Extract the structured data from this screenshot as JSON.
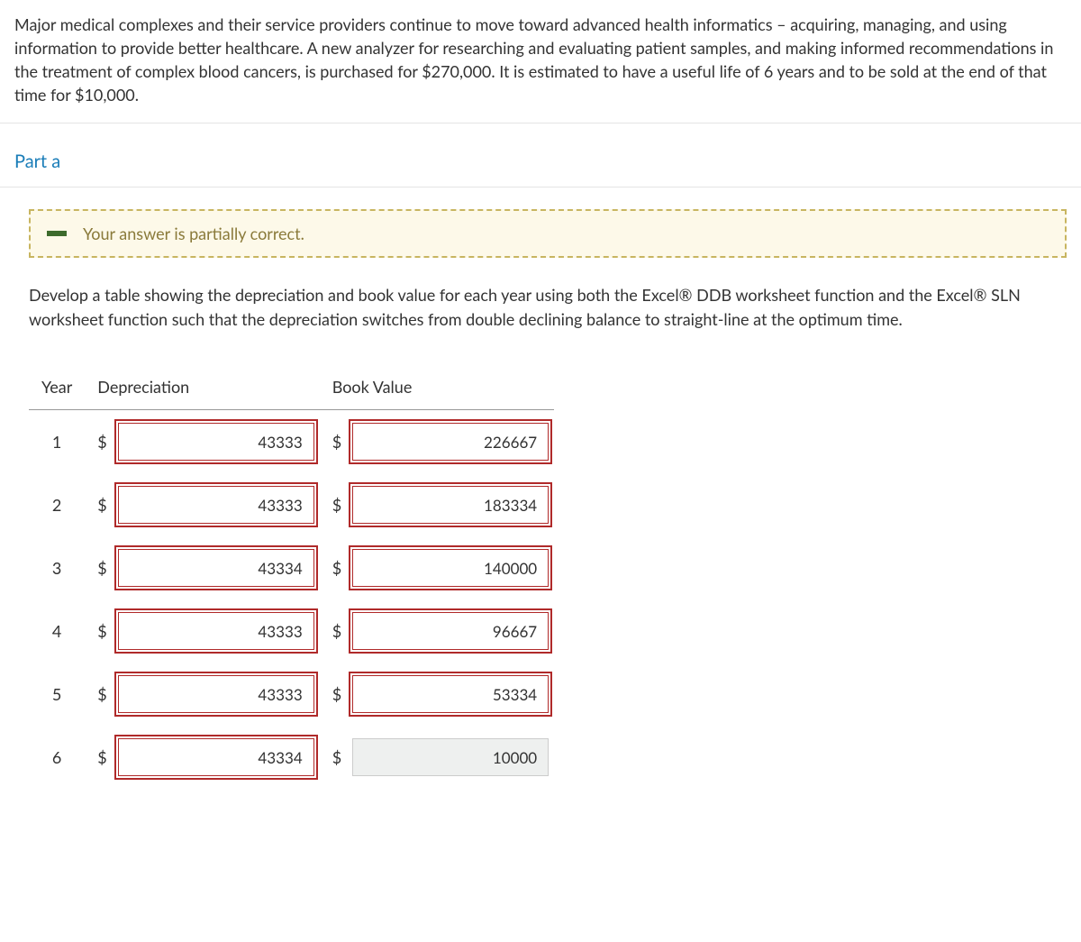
{
  "problem": "Major medical complexes and their service providers continue to move toward advanced health informatics – acquiring, managing, and using information to provide better healthcare. A new analyzer for researching and evaluating patient samples, and making informed recommendations in the treatment of complex blood cancers, is purchased for $270,000. It is estimated to have a useful life of 6 years and to be sold at the end of that time for $10,000.",
  "part_label": "Part a",
  "feedback": "Your answer is partially correct.",
  "instructions": "Develop a table showing the depreciation and book value for each year using both the Excel® DDB worksheet function and the Excel® SLN worksheet function such that the depreciation switches from double declining balance to straight-line at the optimum time.",
  "columns": {
    "year": "Year",
    "depreciation": "Depreciation",
    "book_value": "Book Value"
  },
  "currency": "$",
  "rows": [
    {
      "year": "1",
      "depreciation": "43333",
      "dep_status": "incorrect",
      "book_value": "226667",
      "bv_status": "incorrect"
    },
    {
      "year": "2",
      "depreciation": "43333",
      "dep_status": "incorrect",
      "book_value": "183334",
      "bv_status": "incorrect"
    },
    {
      "year": "3",
      "depreciation": "43334",
      "dep_status": "incorrect",
      "book_value": "140000",
      "bv_status": "incorrect"
    },
    {
      "year": "4",
      "depreciation": "43333",
      "dep_status": "incorrect",
      "book_value": "96667",
      "bv_status": "incorrect"
    },
    {
      "year": "5",
      "depreciation": "43333",
      "dep_status": "incorrect",
      "book_value": "53334",
      "bv_status": "incorrect"
    },
    {
      "year": "6",
      "depreciation": "43334",
      "dep_status": "incorrect",
      "book_value": "10000",
      "bv_status": "correct"
    }
  ]
}
